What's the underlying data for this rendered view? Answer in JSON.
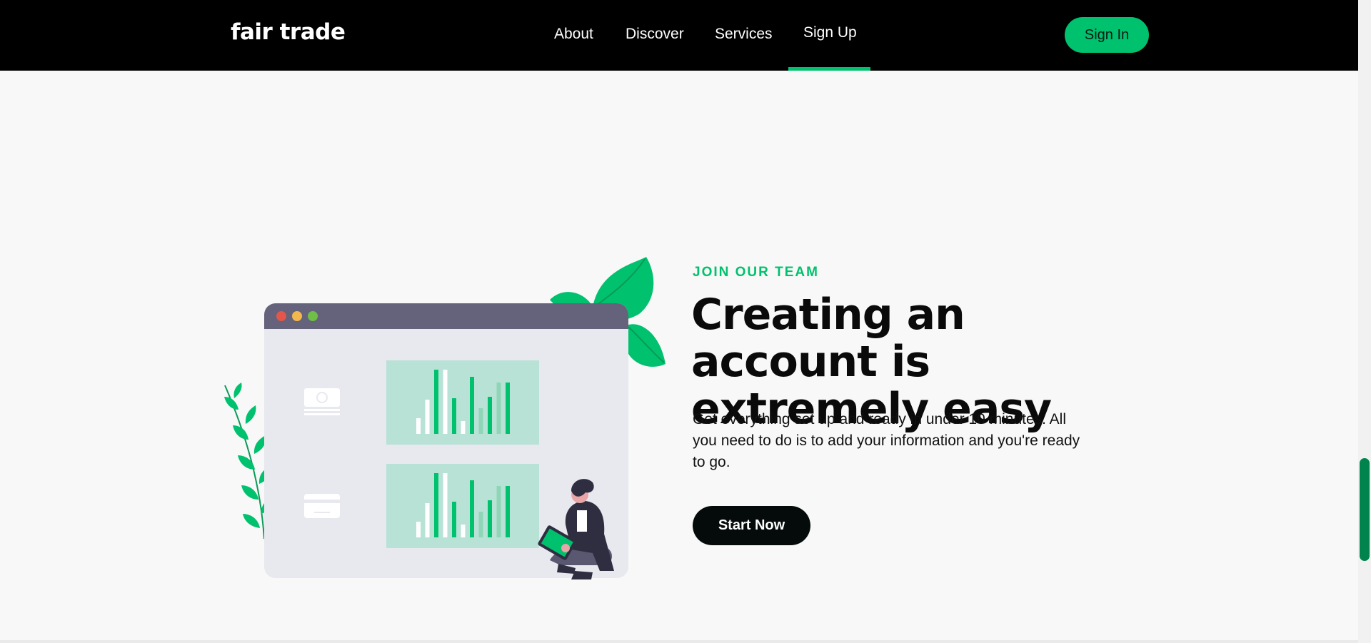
{
  "brand": {
    "logo_text": "fair trade"
  },
  "nav": {
    "items": [
      {
        "label": "About"
      },
      {
        "label": "Discover"
      },
      {
        "label": "Services"
      },
      {
        "label": "Sign Up",
        "active": true
      }
    ],
    "signin_label": "Sign In"
  },
  "hero": {
    "eyebrow": "JOIN OUR TEAM",
    "heading": "Creating an account is extremely easy",
    "body": "Get everything set up and ready in under 10 minutes. All you need to do is to add your information and you're ready to go.",
    "cta_label": "Start Now"
  },
  "colors": {
    "accent": "#00c16e",
    "navbar_bg": "#000000",
    "page_bg": "#f8f8f8",
    "cta_bg": "#050b0b"
  },
  "icons": [
    "banknote-icon",
    "credit-card-icon"
  ]
}
